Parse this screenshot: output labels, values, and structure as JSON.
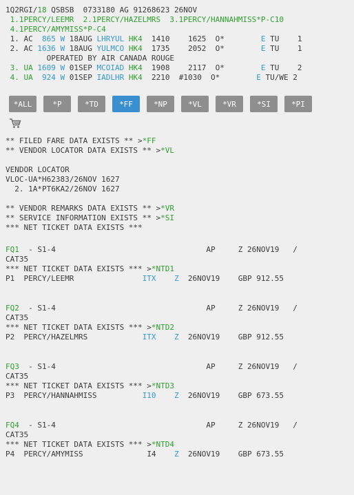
{
  "pnr": {
    "header": {
      "pre": "1Q2RGI/",
      "agent": "18",
      "post": " QSBSB  0733180 AG 91268623 26NOV"
    },
    "names1": {
      "a": " 1.1PERCY/LEEMR  2.1PERCY/HAZELMRS  3.1PERCY/HANNAHMISS*P-C10"
    },
    "names2": {
      "a": " 4.1PERCY/AMYMISS*P-C4"
    },
    "seg1": {
      "pre": " 1. AC  ",
      "flt": "865 W",
      "mid1": " 18AUG ",
      "city": "LHRYUL",
      "hk": " HK4",
      "times": "  1410    1625  O*        ",
      "e": "E",
      "post": " TU    1"
    },
    "seg2": {
      "pre": " 2. AC ",
      "flt": "1636 W",
      "mid1": " 18AUG ",
      "city": "YULMCO",
      "hk": " HK4",
      "times": "  1735    2052  O*        ",
      "e": "E",
      "post": " TU    1"
    },
    "operated": "         OPERATED BY AIR CANADA ROUGE",
    "seg3": {
      "pre": " 3. UA ",
      "flt": "1609 W",
      "mid1": " 01SEP ",
      "city": "MCOIAD",
      "hk": " HK4",
      "times": "  1908    2117  O*        ",
      "e": "E",
      "post": " TU    2"
    },
    "seg4": {
      "pre": " 4. UA  ",
      "flt": "924 W",
      "mid1": " 01SEP ",
      "city": "IADLHR",
      "hk": " HK4",
      "times": "  2210  #1030  O*        ",
      "e": "E",
      "post": " TU/WE 2"
    }
  },
  "toolbar": [
    "*ALL",
    "*P",
    "*TD",
    "*FF",
    "*NP",
    "*VL",
    "*VR",
    "*SI",
    "*PI"
  ],
  "active_tab": "*FF",
  "icons": {
    "cart": "shopping-cart-icon"
  },
  "info": {
    "ff_pre": "** FILED FARE DATA EXISTS ** >",
    "ff_link": "*FF",
    "vl_pre": "** VENDOR LOCATOR DATA EXISTS ** >",
    "vl_link": "*VL",
    "vl_title": "VENDOR LOCATOR",
    "vl_1": "VLOC-UA*H62383/26NOV 1627",
    "vl_2": "  2. 1A*PT6KA2/26NOV 1627",
    "vr_pre": "** VENDOR REMARKS DATA EXISTS ** >",
    "vr_link": "*VR",
    "si_pre": "** SERVICE INFORMATION EXISTS ** >",
    "si_link": "*SI",
    "net": "*** NET TICKET DATA EXISTS ***"
  },
  "fares": [
    {
      "fq": "FQ1",
      "seg": "  - S1-4                                 AP     Z 26NOV19   /",
      "cat": "CAT35",
      "net_pre": "*** NET TICKET DATA EXISTS *** >",
      "net_link": "*NTD1",
      "p": "P1  PERCY/LEEMR               ",
      "code": "ITX",
      "z": "Z",
      "date": "  26NOV19    GBP 912.55",
      "pad": "    "
    },
    {
      "fq": "FQ2",
      "seg": "  - S1-4                                 AP     Z 26NOV19   /",
      "cat": "CAT35",
      "net_pre": "*** NET TICKET DATA EXISTS *** >",
      "net_link": "*NTD2",
      "p": "P2  PERCY/HAZELMRS            ",
      "code": "ITX",
      "z": "Z",
      "date": "  26NOV19    GBP 912.55",
      "pad": "    "
    },
    {
      "fq": "FQ3",
      "seg": "  - S1-4                                 AP     Z 26NOV19   /",
      "cat": "CAT35",
      "net_pre": "*** NET TICKET DATA EXISTS *** >",
      "net_link": "*NTD3",
      "p": "P3  PERCY/HANNAHMISS          ",
      "code": "I10",
      "z": "Z",
      "date": "  26NOV19    GBP 673.55",
      "pad": "    "
    },
    {
      "fq": "FQ4",
      "seg": "  - S1-4                                 AP     Z 26NOV19   /",
      "cat": "CAT35",
      "net_pre": "*** NET TICKET DATA EXISTS *** >",
      "net_link": "*NTD4",
      "p": "P4  PERCY/AMYMISS              ",
      "code": "I4",
      "z": "Z",
      "date": "  26NOV19    GBP 673.55",
      "pad": "    "
    }
  ]
}
